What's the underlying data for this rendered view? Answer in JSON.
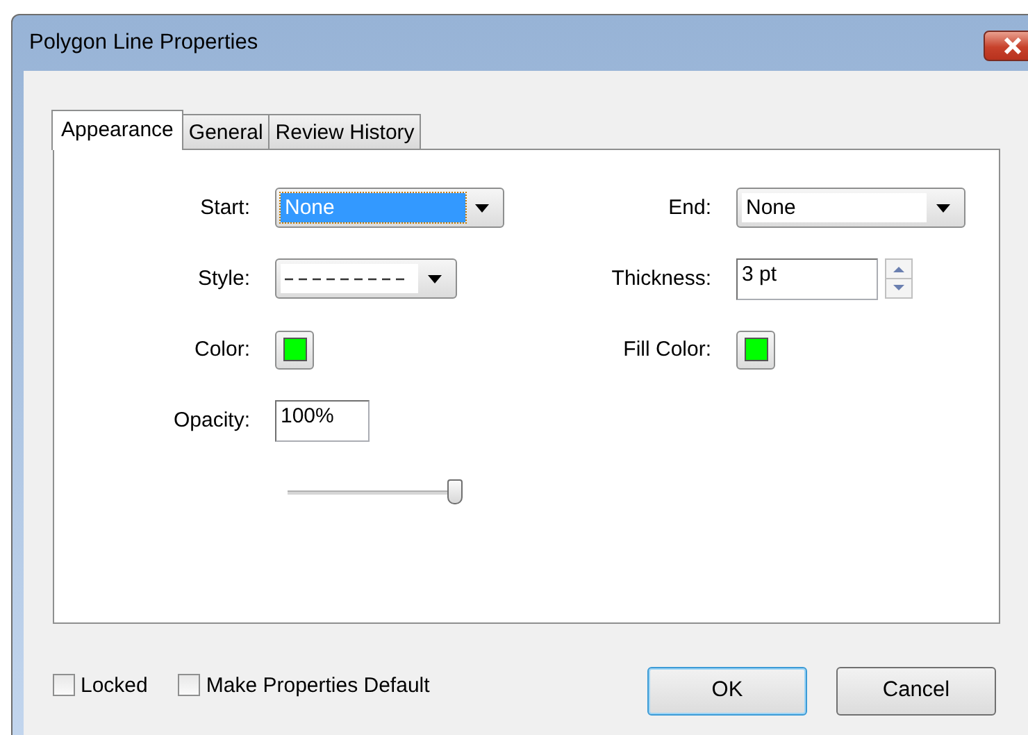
{
  "window": {
    "title": "Polygon Line Properties"
  },
  "tabs": [
    {
      "label": "Appearance",
      "selected": true
    },
    {
      "label": "General",
      "selected": false
    },
    {
      "label": "Review History",
      "selected": false
    }
  ],
  "left_fields": [
    {
      "kind": "dropdown",
      "label": "Start:",
      "value": "None",
      "focused": true
    },
    {
      "kind": "line-style",
      "label": "Style:"
    },
    {
      "kind": "color",
      "label": "Color:",
      "color": "#00ff00"
    },
    {
      "kind": "text",
      "label": "Opacity:",
      "value": "100%"
    },
    {
      "kind": "slider",
      "level": 0.95
    }
  ],
  "right_fields": [
    {
      "kind": "dropdown",
      "label": "End:",
      "value": "None",
      "focused": false
    },
    {
      "kind": "spin",
      "label": "Thickness:",
      "value": "3 pt"
    },
    {
      "kind": "color",
      "label": "Fill Color:",
      "color": "#00ff00"
    }
  ],
  "checkboxes": [
    {
      "label": "Locked",
      "checked": false
    },
    {
      "label": "Make Properties Default",
      "checked": false
    }
  ],
  "buttons": [
    {
      "label": "OK",
      "default": true
    },
    {
      "label": "Cancel",
      "default": false
    }
  ]
}
